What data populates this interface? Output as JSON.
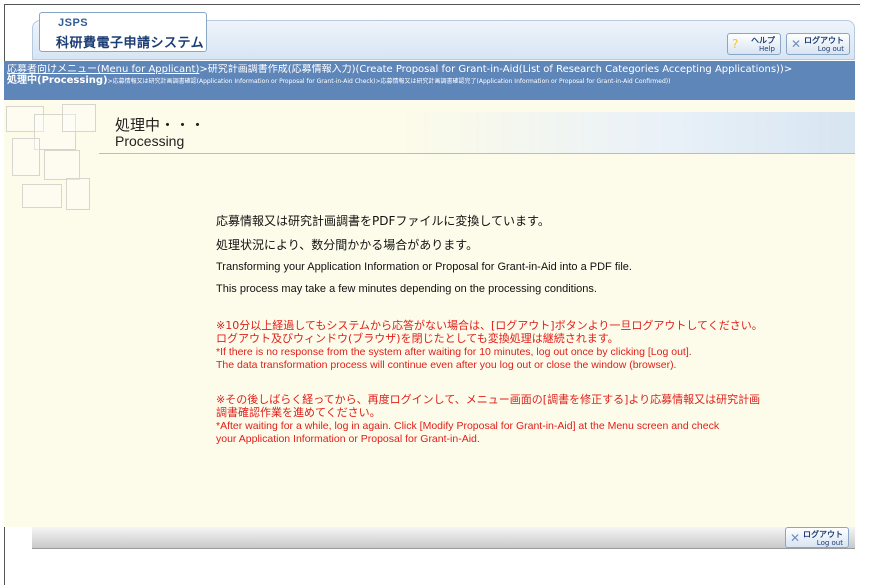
{
  "header": {
    "logo_small": "JSPS",
    "system_name": "科研費電子申請システム",
    "help": {
      "jp": "ヘルプ",
      "en": "Help"
    },
    "logout": {
      "jp": "ログアウト",
      "en": "Log out"
    }
  },
  "breadcrumb": {
    "link_menu": "応募者向けメニュー(Menu for Applicant)",
    "step2": ">研究計画調書作成(応募情報入力)(Create Proposal for Grant-in-Aid(List of Research Categories Accepting Applications))>",
    "current": "処理中(Processing)",
    "step4": ">応募情報又は研究計画調書確認(Application Information or Proposal for Grant-in-Aid Check)>応募情報又は研究計画調書確認完了(Application Information or Proposal for Grant-in-Aid Confirmed))"
  },
  "title": {
    "jp": "処理中・・・",
    "en": "Processing"
  },
  "messages": {
    "jp1": "応募情報又は研究計画調書をPDFファイルに変換しています。",
    "jp2": "処理状況により、数分間かかる場合があります。",
    "en1": "Transforming your Application Information or Proposal for Grant-in-Aid into a PDF file.",
    "en2": "This process may take a few minutes depending on the processing conditions."
  },
  "warnings": {
    "w1_jp1": "※10分以上経過してもシステムから応答がない場合は、[ログアウト]ボタンより一旦ログアウトしてください。",
    "w1_jp2": "ログアウト及びウィンドウ(ブラウザ)を閉じたとしても変換処理は継続されます。",
    "w1_en1": "*If there is no response from the system after waiting for 10 minutes, log out once by clicking [Log out].",
    "w1_en2": "The data transformation process will continue even after you log out or close the window (browser).",
    "w2_jp1": "※その後しばらく経ってから、再度ログインして、メニュー画面の[調書を修正する]より応募情報又は研究計画",
    "w2_jp2": "調書確認作業を進めてください。",
    "w2_en1": "*After waiting for a while, log in again. Click [Modify Proposal for Grant-in-Aid] at the Menu screen and check",
    "w2_en2": "your Application Information or Proposal for Grant-in-Aid."
  },
  "colors": {
    "nav": "#5f86b9",
    "warning": "#e0201b",
    "content_bg": "#fdfbe9"
  },
  "icons": {
    "help": "question-icon",
    "logout": "x-icon"
  }
}
